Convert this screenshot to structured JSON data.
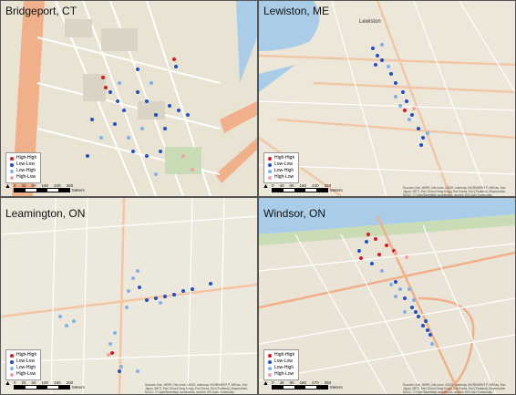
{
  "panels": [
    {
      "key": "bridgeport",
      "title": "Bridgeport, CT",
      "scale_ticks": [
        "0",
        "40",
        "80",
        "160",
        "240",
        "320"
      ],
      "scale_units": "Meters",
      "legend": [
        "High-High",
        "Low-Low",
        "Low-High",
        "High-Low"
      ]
    },
    {
      "key": "lewiston",
      "title": "Lewiston, ME",
      "scale_ticks": [
        "0",
        "40",
        "80",
        "160",
        "240",
        "320"
      ],
      "scale_units": "Meters",
      "legend": [
        "High-High",
        "Low-Low",
        "Low-High",
        "High-Low"
      ],
      "map_label": "Lewiston"
    },
    {
      "key": "leamington",
      "title": "Leamington, ON",
      "scale_ticks": [
        "0",
        "25",
        "50",
        "100",
        "150",
        "200"
      ],
      "scale_units": "Meters",
      "legend": [
        "High-High",
        "Low-Low",
        "Low-High",
        "High-Low"
      ]
    },
    {
      "key": "windsor",
      "title": "Windsor, ON",
      "scale_ticks": [
        "0",
        "45",
        "90",
        "180",
        "270",
        "360"
      ],
      "scale_units": "Meters",
      "legend": [
        "High-High",
        "Low-Low",
        "Low-High",
        "High-Low"
      ]
    }
  ],
  "credit": "Sources: Esri, HERE, DeLorme, USGS, Intermap, INCREMENT P, NRCan, Esri Japan, METI, Esri China (Hong Kong), Esri Korea, Esri (Thailand), MapmyIndia, NGCC, © OpenStreetMap contributors, and the GIS User Community",
  "colors": {
    "high_high": "#d7191c",
    "low_low": "#1f4fc8",
    "low_high": "#7fb0ea",
    "high_low": "#f4a0a6",
    "water": "#a9cde8",
    "land": "#ede7da",
    "road": "#f3c7a6"
  },
  "north_symbol": "north-arrow-icon"
}
